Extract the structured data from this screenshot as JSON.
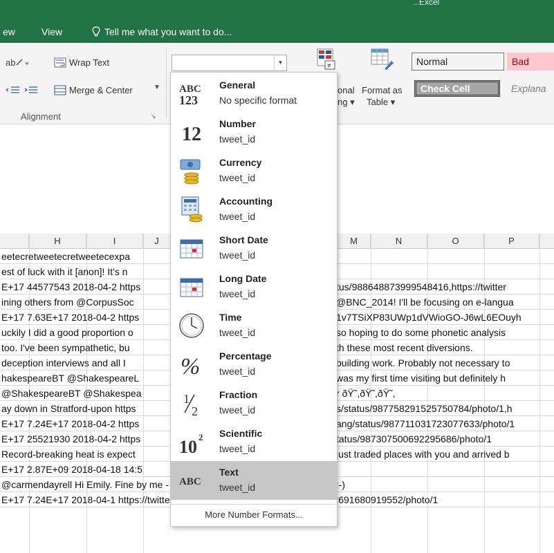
{
  "window": {
    "title_fragment": "...Excel"
  },
  "menu": {
    "view_tab": "View",
    "partial_tab": "ew",
    "tell_me": "Tell me what you want to do..."
  },
  "ribbon": {
    "wrap_text": "Wrap Text",
    "merge_center": "Merge & Center",
    "alignment_group": "Alignment",
    "conditional_line1": "onal",
    "conditional_line2": "ng",
    "format_as_table_line1": "Format as",
    "format_as_table_line2": "Table",
    "styles": [
      {
        "label": "Normal",
        "bg": "#ffffff",
        "fg": "#000000"
      },
      {
        "label": "Bad",
        "bg": "#ffc7ce",
        "fg": "#9c0006"
      },
      {
        "label": "Check Cell",
        "bg": "#a5a5a5",
        "fg": "#ffffff"
      },
      {
        "label": "Explana",
        "bg": "#ffffff",
        "fg": "#7f7f7f"
      }
    ]
  },
  "number_format": {
    "current_value": "",
    "more_formats": "More Number Formats...",
    "options": [
      {
        "name": "General",
        "sample": "No specific format",
        "icon": "general-abc123-icon"
      },
      {
        "name": "Number",
        "sample": "tweet_id",
        "icon": "number-12-icon"
      },
      {
        "name": "Currency",
        "sample": "tweet_id",
        "icon": "currency-icon"
      },
      {
        "name": "Accounting",
        "sample": "tweet_id",
        "icon": "accounting-icon"
      },
      {
        "name": "Short Date",
        "sample": "tweet_id",
        "icon": "short-date-icon"
      },
      {
        "name": "Long Date",
        "sample": "tweet_id",
        "icon": "long-date-icon"
      },
      {
        "name": "Time",
        "sample": "tweet_id",
        "icon": "clock-icon"
      },
      {
        "name": "Percentage",
        "sample": "tweet_id",
        "icon": "percent-icon"
      },
      {
        "name": "Fraction",
        "sample": "tweet_id",
        "icon": "fraction-icon"
      },
      {
        "name": "Scientific",
        "sample": "tweet_id",
        "icon": "scientific-icon"
      },
      {
        "name": "Text",
        "sample": "tweet_id",
        "icon": "text-abc-icon",
        "selected": true
      }
    ]
  },
  "sheet": {
    "columns": [
      "H",
      "I",
      "J",
      "M",
      "N",
      "O",
      "P"
    ],
    "rows": [
      {
        "left": "eetecretweetecretweetecexpa",
        "right": ""
      },
      {
        "left": "est of luck with it [anon]! It's n",
        "right": ""
      },
      {
        "left": "E+17  44577543 2018-04-2 https",
        "right": "tus/988648873999548416,https://twitter"
      },
      {
        "left": "ining others from @CorpusSoc",
        "right": "@BNC_2014! I'll be focusing on e-langua"
      },
      {
        "left": "E+17  7.63E+17 2018-04-2 https",
        "right": "1v7TSiXP83UWp1dVWioGO-J6wL6EOuyh"
      },
      {
        "left": "uckily I did a good proportion o",
        "right": "so hoping to do some phonetic analysis"
      },
      {
        "left": "too. I've been sympathetic, bu",
        "right": "th these most recent diversions."
      },
      {
        "left": "deception interviews and all I",
        "right": "building work. Probably not necessary to"
      },
      {
        "left": "hakespeareBT @ShakespeareL",
        "right": "was my first time visiting but definitely h"
      },
      {
        "left": "@ShakespeareBT @Shakespea",
        "right": "r ðŸ˜,ðŸ˜,ðŸ˜,"
      },
      {
        "left": "ay down in Stratford-upon https",
        "right": "s/status/987758291525750784/photo/1,h"
      },
      {
        "left": "E+17  7.24E+17 2018-04-2 https",
        "right": "ang/status/987711031723077633/photo/1"
      },
      {
        "left": "E+17  25521930 2018-04-2 https",
        "right": "tatus/987307500692295686/photo/1"
      },
      {
        "left": "Record-breaking heat is expect",
        "right": "just traded places with you and arrived b"
      },
      {
        "left": "E+17  2.87E+09 2018-04-18 14:5",
        "right": ""
      },
      {
        "left": "@carmendayrell Hi Emily. Fine by me - please credit using my Twitter handle. :-)",
        "right": ""
      },
      {
        "left": "E+17  7.24E+17 2018-04-1 https://twitter.com/ShakespeareLang/status/986362691680919552/photo/1",
        "right": ""
      }
    ]
  }
}
